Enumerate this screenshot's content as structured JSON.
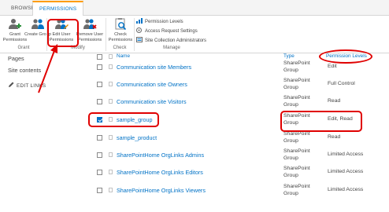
{
  "tabs": {
    "browse": "BROWSE",
    "permissions": "PERMISSIONS"
  },
  "ribbon": {
    "grant_permissions": "Grant Permissions",
    "create_group": "Create Group",
    "edit_user_permissions": "Edit User Permissions",
    "remove_user_permissions": "Remove User Permissions",
    "check_permissions": "Check Permissions",
    "permission_levels": "Permission Levels",
    "access_request_settings": "Access Request Settings",
    "site_collection_administrators": "Site Collection Administrators",
    "group_grant": "Grant",
    "group_modify": "Modify",
    "group_check": "Check",
    "group_manage": "Manage"
  },
  "nav": {
    "pages": "Pages",
    "site_contents": "Site contents",
    "edit_links": "EDIT LINKS"
  },
  "table": {
    "headers": {
      "name": "Name",
      "type": "Type",
      "permission_levels": "Permission Levels"
    },
    "rows": [
      {
        "name": "Communication site Members",
        "type": "SharePoint Group",
        "perm": "Edit",
        "checked": false
      },
      {
        "name": "Communication site Owners",
        "type": "SharePoint Group",
        "perm": "Full Control",
        "checked": false
      },
      {
        "name": "Communication site Visitors",
        "type": "SharePoint Group",
        "perm": "Read",
        "checked": false
      },
      {
        "name": "sample_group",
        "type": "SharePoint Group",
        "perm": "Edit, Read",
        "checked": true
      },
      {
        "name": "sample_product",
        "type": "SharePoint Group",
        "perm": "Read",
        "checked": false
      },
      {
        "name": "SharePointHome OrgLinks Admins",
        "type": "SharePoint Group",
        "perm": "Limited Access",
        "checked": false
      },
      {
        "name": "SharePointHome OrgLinks Editors",
        "type": "SharePoint Group",
        "perm": "Limited Access",
        "checked": false
      },
      {
        "name": "SharePointHome OrgLinks Viewers",
        "type": "SharePoint Group",
        "perm": "Limited Access",
        "checked": false
      }
    ]
  },
  "colors": {
    "link": "#0072c6",
    "accent_tab": "#ff9c00",
    "annotation": "#e00000"
  }
}
